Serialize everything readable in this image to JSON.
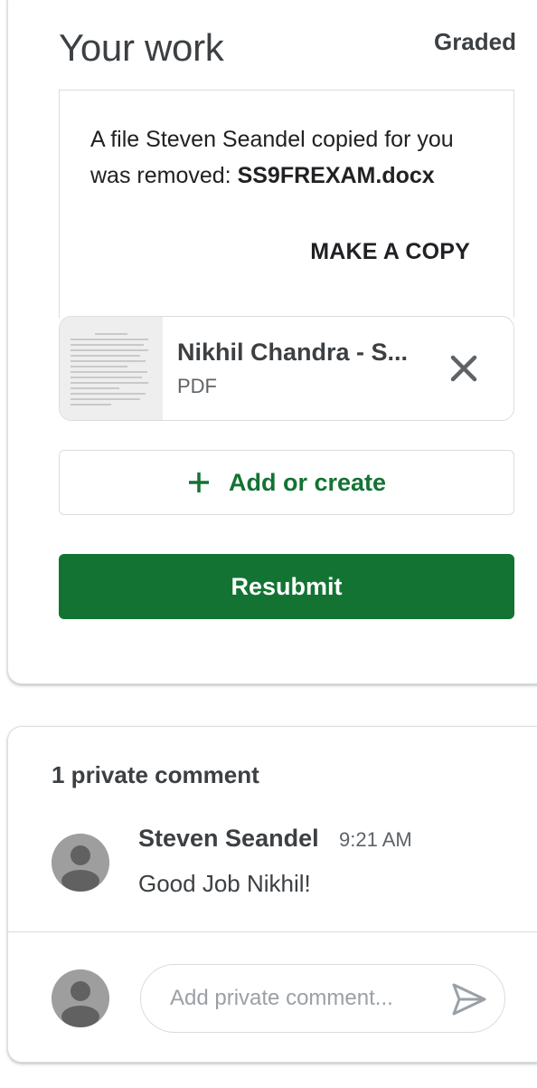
{
  "work": {
    "title": "Your work",
    "status": "Graded",
    "removed_notice": {
      "text": "A file Steven Seandel copied for you was removed: ",
      "filename": "SS9FREXAM.docx",
      "make_copy_label": "MAKE A COPY"
    },
    "attachment": {
      "name": "Nikhil Chandra - S...",
      "type": "PDF",
      "thumbnail_icon": "pdf-thumbnail",
      "remove_icon": "close-icon"
    },
    "add_create_label": "Add or create",
    "add_icon": "plus-icon",
    "resubmit_label": "Resubmit"
  },
  "comments": {
    "heading": "1 private comment",
    "items": [
      {
        "author": "Steven Seandel",
        "time": "9:21 AM",
        "text": "Good Job Nikhil!",
        "avatar_icon": "avatar-icon"
      }
    ],
    "input_placeholder": "Add private comment...",
    "send_icon": "send-icon"
  },
  "colors": {
    "primary_green": "#137333",
    "border": "#dadce0",
    "text_dark": "#3c4043",
    "text_muted": "#5f6368",
    "avatar_gray": "#9e9e9e"
  }
}
